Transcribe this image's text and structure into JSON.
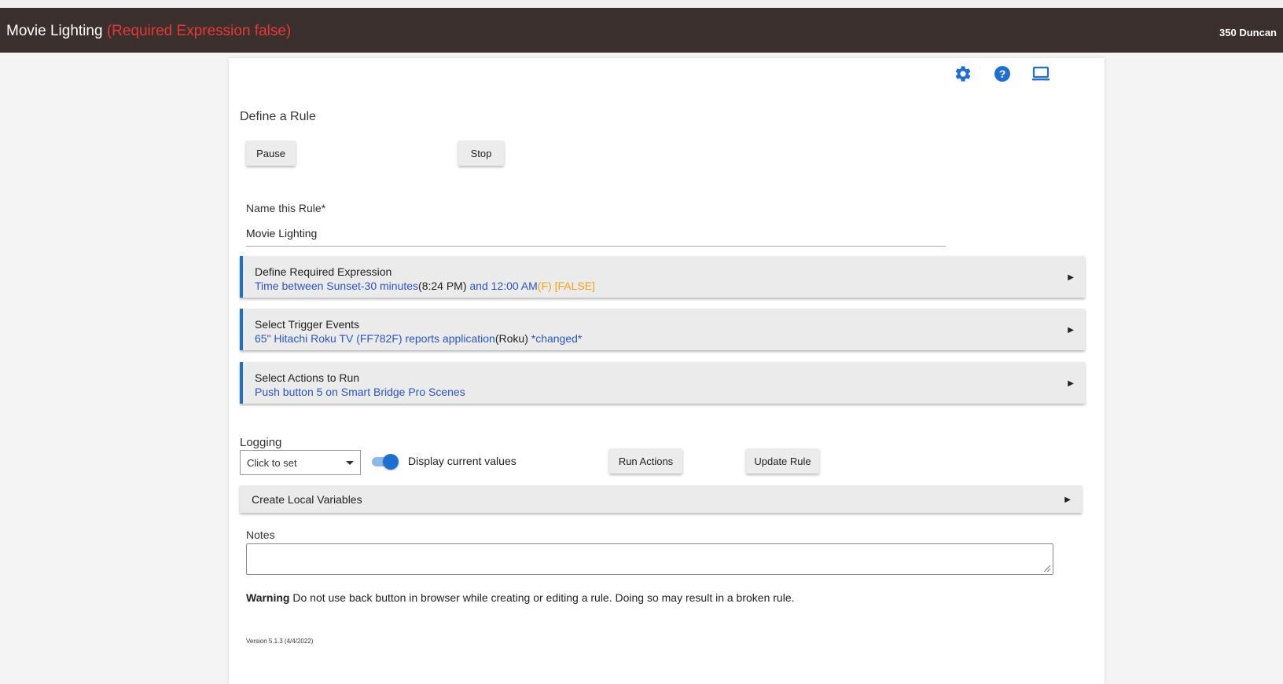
{
  "header": {
    "title": "Movie Lighting",
    "status": "(Required Expression false)",
    "hub_name": "350 Duncan"
  },
  "toolbar_icons": [
    "gear-icon",
    "help-icon",
    "laptop-icon"
  ],
  "page": {
    "title": "Define a Rule",
    "pause_label": "Pause",
    "stop_label": "Stop"
  },
  "rule_name": {
    "label": "Name this Rule*",
    "value": "Movie Lighting"
  },
  "sections": {
    "required_expression": {
      "title": "Define Required Expression",
      "detail_part1": "Time between Sunset-30 minutes",
      "detail_part2": "(8:24 PM)",
      "detail_part3": " and 12:00 AM",
      "detail_part4": "(F) [FALSE]"
    },
    "trigger_events": {
      "title": "Select Trigger Events",
      "detail_part1": "65\" Hitachi Roku TV (FF782F) reports application",
      "detail_part2": "(Roku)",
      "detail_part3": " *changed*"
    },
    "actions": {
      "title": "Select Actions to Run",
      "detail": "Push button 5 on Smart Bridge Pro Scenes"
    },
    "local_variables": {
      "title": "Create Local Variables"
    }
  },
  "logging": {
    "label": "Logging",
    "selected": "Click to set",
    "display_values_label": "Display current values",
    "display_values_on": true
  },
  "buttons": {
    "run_actions": "Run Actions",
    "update_rule": "Update Rule"
  },
  "notes": {
    "label": "Notes",
    "value": ""
  },
  "warning": {
    "bold": "Warning",
    "text": " Do not use back button in browser while creating or editing a rule. Doing so may result in a broken rule."
  },
  "version": "Version 5.1.3 (4/4/2022)",
  "colors": {
    "header_bg": "#3b302d",
    "status_red": "#e53935",
    "accent_blue": "#1e6fcf",
    "link_blue": "#2b55c3",
    "false_orange": "#f2a21a"
  }
}
